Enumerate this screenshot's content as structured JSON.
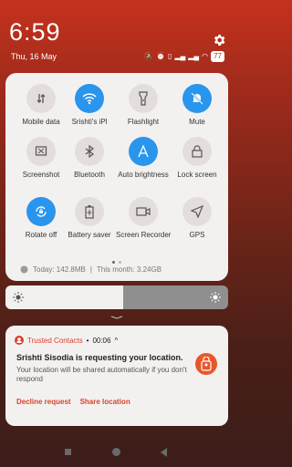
{
  "status": {
    "time": "6:59",
    "date": "Thu, 16 May",
    "battery": "77"
  },
  "tiles": [
    {
      "label": "Mobile data",
      "icon": "mobile-data-icon",
      "active": false
    },
    {
      "label": "Srishti's iPl",
      "icon": "wifi-icon",
      "active": true
    },
    {
      "label": "Flashlight",
      "icon": "flashlight-icon",
      "active": false
    },
    {
      "label": "Mute",
      "icon": "mute-bell-icon",
      "active": true
    },
    {
      "label": "Screenshot",
      "icon": "screenshot-icon",
      "active": false
    },
    {
      "label": "Bluetooth",
      "icon": "bluetooth-icon",
      "active": false
    },
    {
      "label": "Auto brightness",
      "icon": "auto-brightness-icon",
      "active": true
    },
    {
      "label": "Lock screen",
      "icon": "lock-icon",
      "active": false
    },
    {
      "label": "Rotate off",
      "icon": "rotate-lock-icon",
      "active": true
    },
    {
      "label": "Battery saver",
      "icon": "battery-saver-icon",
      "active": false
    },
    {
      "label": "Screen Recorder",
      "icon": "video-camera-icon",
      "active": false
    },
    {
      "label": "GPS",
      "icon": "location-arrow-icon",
      "active": false
    }
  ],
  "data_usage": {
    "today": "Today: 142.8MB",
    "month": "This month: 3.24GB"
  },
  "brightness_level": 0.53,
  "notification": {
    "app_name": "Trusted Contacts",
    "separator": "•",
    "time": "00:06",
    "expand_glyph": "^",
    "title": "Srishti Sisodia is requesting your location.",
    "body": "Your location will be shared automatically if you don't respond",
    "actions": [
      "Decline request",
      "Share location"
    ]
  },
  "colors": {
    "accent_blue": "#2a95ec",
    "notification_red": "#d8412b",
    "background_red": "#c5321d"
  }
}
